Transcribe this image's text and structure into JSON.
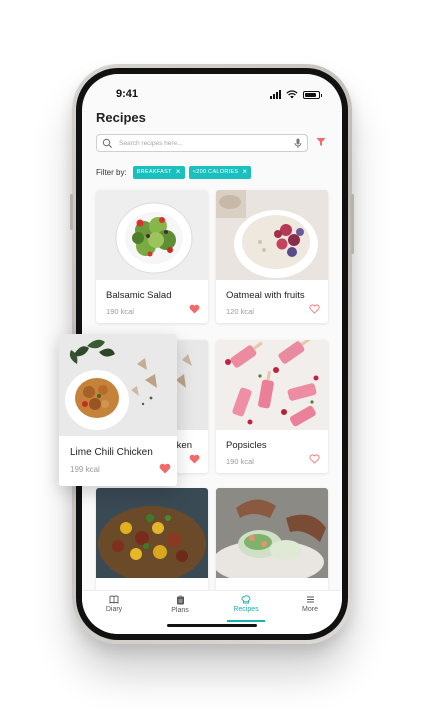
{
  "status_bar": {
    "time": "9:41"
  },
  "page": {
    "title": "Recipes"
  },
  "search": {
    "placeholder": "Search recipes here..."
  },
  "filter": {
    "label": "Filter by:",
    "chips": [
      "BREAKFAST",
      "<200 CALORIES"
    ]
  },
  "recipes": [
    {
      "name": "Balsamic Salad",
      "kcal": "190 kcal",
      "favorite": true
    },
    {
      "name": "Oatmeal with fruits",
      "kcal": "120 kcal",
      "favorite": false
    },
    {
      "name": "Lime Chili Chicken",
      "kcal": "199 kcal",
      "favorite": true
    },
    {
      "name": "Popsicles",
      "kcal": "190 kcal",
      "favorite": false
    }
  ],
  "hidden_card_text": "ken",
  "tabs": [
    {
      "label": "Diary",
      "icon": "book-icon",
      "active": false
    },
    {
      "label": "Plans",
      "icon": "clipboard-icon",
      "active": false
    },
    {
      "label": "Recipes",
      "icon": "chef-hat-icon",
      "active": true
    },
    {
      "label": "More",
      "icon": "menu-icon",
      "active": false
    }
  ],
  "colors": {
    "accent": "#1bbfbe",
    "heart": "#f26b6b",
    "background": "#fafafa"
  }
}
